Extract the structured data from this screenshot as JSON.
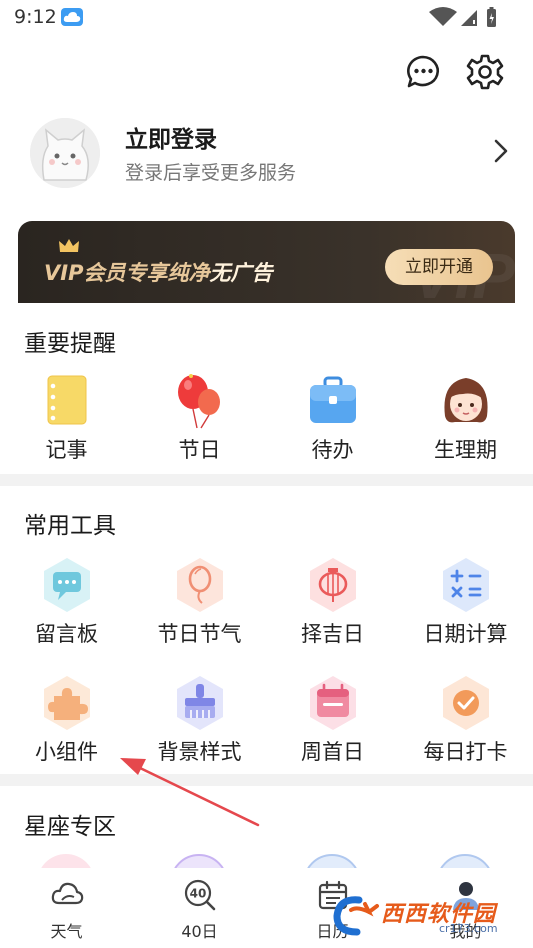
{
  "status_bar": {
    "time": "9:12"
  },
  "profile": {
    "name": "立即登录",
    "subtitle": "登录后享受更多服务"
  },
  "vip_banner": {
    "text_highlight": "VIP会员专享纯净",
    "text_plain": "无广告",
    "button_label": "立即开通",
    "watermark": "VIP"
  },
  "reminders": {
    "title": "重要提醒",
    "items": [
      {
        "label": "记事",
        "icon": "notebook-icon"
      },
      {
        "label": "节日",
        "icon": "balloons-icon"
      },
      {
        "label": "待办",
        "icon": "briefcase-icon"
      },
      {
        "label": "生理期",
        "icon": "girl-face-icon"
      }
    ]
  },
  "tools": {
    "title": "常用工具",
    "items": [
      {
        "label": "留言板",
        "icon": "message-board-icon"
      },
      {
        "label": "节日节气",
        "icon": "balloon-icon"
      },
      {
        "label": "择吉日",
        "icon": "lantern-icon"
      },
      {
        "label": "日期计算",
        "icon": "calculator-icon"
      },
      {
        "label": "小组件",
        "icon": "puzzle-icon"
      },
      {
        "label": "背景样式",
        "icon": "brush-icon"
      },
      {
        "label": "周首日",
        "icon": "calendar-icon"
      },
      {
        "label": "每日打卡",
        "icon": "checkmark-icon"
      }
    ]
  },
  "horoscope": {
    "title": "星座专区"
  },
  "tab_bar": {
    "items": [
      {
        "label": "天气",
        "icon": "cloud-icon"
      },
      {
        "label": "40日",
        "icon": "forty-day-search-icon"
      },
      {
        "label": "日历",
        "icon": "calendar-icon"
      },
      {
        "label": "我的",
        "icon": "user-icon"
      }
    ]
  },
  "site_watermark": {
    "text": "西西软件园",
    "url": "cr173.com"
  },
  "colors": {
    "vip_gold": "#e7c79a",
    "vip_bg": "#2a2520",
    "divider": "#f2f2f2",
    "arrow": "#e5484d"
  }
}
